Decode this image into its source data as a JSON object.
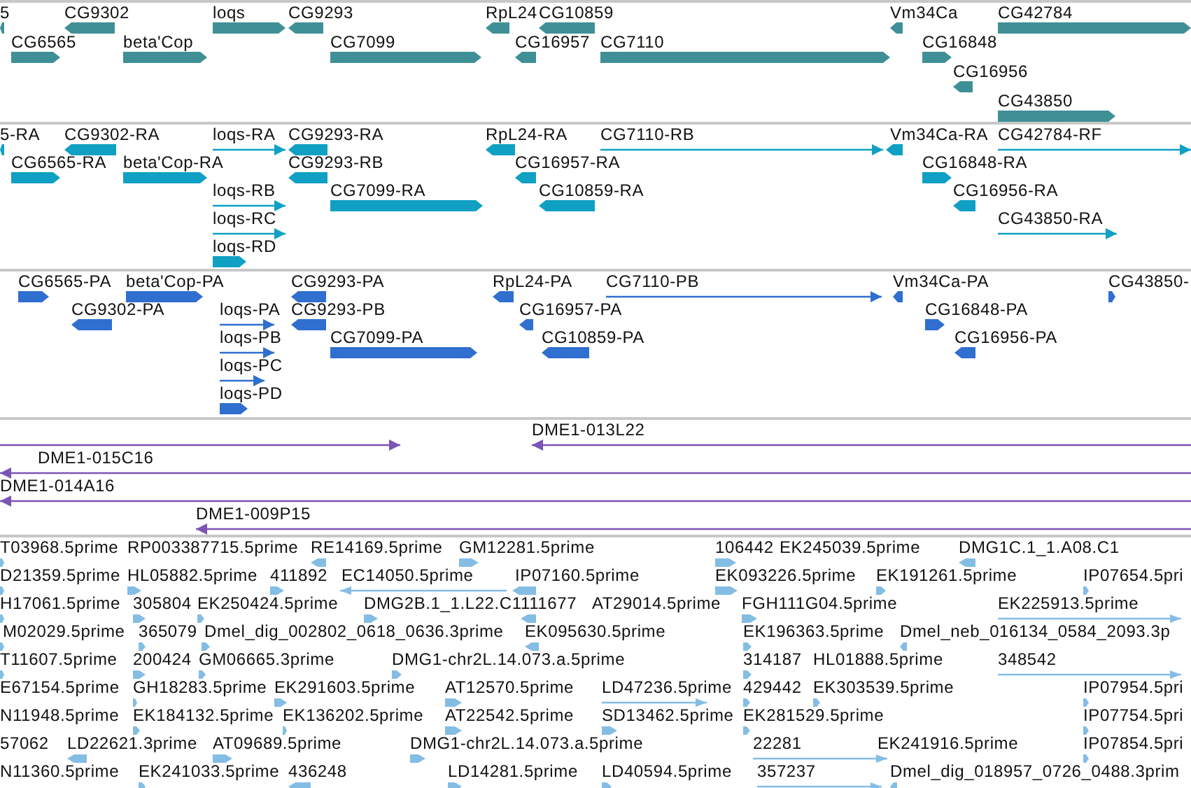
{
  "tracks": [
    {
      "kind": "gene",
      "features": [
        {
          "label": "5",
          "reverse": true
        },
        {
          "label": "CG9302",
          "reverse": true
        },
        {
          "label": "loqs",
          "reverse": false
        },
        {
          "label": "CG9293",
          "reverse": true
        },
        {
          "label": "RpL24",
          "reverse": true
        },
        {
          "label": "CG10859",
          "reverse": true
        },
        {
          "label": "Vm34Ca",
          "reverse": true
        },
        {
          "label": "CG42784",
          "reverse": false
        },
        {
          "label": "CG6565",
          "reverse": false
        },
        {
          "label": "beta'Cop",
          "reverse": false
        },
        {
          "label": "CG7099",
          "reverse": false
        },
        {
          "label": "CG16957",
          "reverse": true
        },
        {
          "label": "CG7110",
          "reverse": false
        },
        {
          "label": "CG16848",
          "reverse": false
        },
        {
          "label": "CG16956",
          "reverse": true
        },
        {
          "label": "CG43850",
          "reverse": false
        }
      ]
    },
    {
      "kind": "transcript",
      "features": [
        {
          "label": "5-RA",
          "reverse": true
        },
        {
          "label": "CG9302-RA",
          "reverse": true
        },
        {
          "label": "loqs-RA",
          "reverse": false
        },
        {
          "label": "CG9293-RA",
          "reverse": true
        },
        {
          "label": "RpL24-RA",
          "reverse": true
        },
        {
          "label": "CG7110-RB",
          "reverse": false
        },
        {
          "label": "Vm34Ca-RA",
          "reverse": true
        },
        {
          "label": "CG42784-RF",
          "reverse": false
        },
        {
          "label": "CG6565-RA",
          "reverse": false
        },
        {
          "label": "beta'Cop-RA",
          "reverse": false
        },
        {
          "label": "CG9293-RB",
          "reverse": true
        },
        {
          "label": "CG16957-RA",
          "reverse": true
        },
        {
          "label": "CG16848-RA",
          "reverse": false
        },
        {
          "label": "loqs-RB",
          "reverse": false
        },
        {
          "label": "CG7099-RA",
          "reverse": false
        },
        {
          "label": "CG10859-RA",
          "reverse": true
        },
        {
          "label": "CG16956-RA",
          "reverse": true
        },
        {
          "label": "loqs-RC",
          "reverse": false
        },
        {
          "label": "CG43850-RA",
          "reverse": false
        },
        {
          "label": "loqs-RD",
          "reverse": false
        }
      ]
    },
    {
      "kind": "protein",
      "features": [
        {
          "label": "CG6565-PA",
          "reverse": false
        },
        {
          "label": "beta'Cop-PA",
          "reverse": false
        },
        {
          "label": "CG9293-PA",
          "reverse": true
        },
        {
          "label": "RpL24-PA",
          "reverse": true
        },
        {
          "label": "CG7110-PB",
          "reverse": false
        },
        {
          "label": "Vm34Ca-PA",
          "reverse": true
        },
        {
          "label": "CG43850-",
          "reverse": false
        },
        {
          "label": "CG9302-PA",
          "reverse": true
        },
        {
          "label": "loqs-PA",
          "reverse": false
        },
        {
          "label": "CG9293-PB",
          "reverse": true
        },
        {
          "label": "CG16957-PA",
          "reverse": true
        },
        {
          "label": "CG16848-PA",
          "reverse": false
        },
        {
          "label": "loqs-PB",
          "reverse": false
        },
        {
          "label": "CG7099-PA",
          "reverse": false
        },
        {
          "label": "CG10859-PA",
          "reverse": true
        },
        {
          "label": "CG16956-PA",
          "reverse": true
        },
        {
          "label": "loqs-PC",
          "reverse": false
        },
        {
          "label": "loqs-PD",
          "reverse": false
        }
      ]
    },
    {
      "kind": "clone",
      "features": [
        {
          "reverse": false
        },
        {
          "label": "DME1-013L22",
          "reverse": true
        },
        {
          "label": "DME1-015C16",
          "reverse": true
        },
        {
          "label": "DME1-014A16",
          "reverse": true
        },
        {
          "label": "DME1-009P15",
          "reverse": true
        }
      ]
    },
    {
      "kind": "est",
      "features": [
        {
          "label": "T03968.5prime",
          "reverse": false
        },
        {
          "label": "RP003387715.5prime"
        },
        {
          "label": "RE14169.5prime",
          "reverse": true
        },
        {
          "label": "GM12281.5prime",
          "reverse": false
        },
        {
          "label": "106442",
          "reverse": false
        },
        {
          "label": "EK245039.5prime"
        },
        {
          "label": "DMG1C.1_1.A08.C1",
          "reverse": true
        },
        {
          "label": "D21359.5prime",
          "reverse": false
        },
        {
          "label": "HL05882.5prime",
          "reverse": false
        },
        {
          "label": "411892",
          "reverse": false
        },
        {
          "label": "EC14050.5prime",
          "reverse": true
        },
        {
          "label": "IP07160.5prime",
          "reverse": true
        },
        {
          "label": "EK093226.5prime",
          "reverse": false
        },
        {
          "label": "EK191261.5prime",
          "reverse": false
        },
        {
          "label": "IP07654.5pri",
          "reverse": false
        },
        {
          "label": "H17061.5prime",
          "reverse": false
        },
        {
          "label": "305804",
          "reverse": false
        },
        {
          "label": "EK250424.5prime",
          "reverse": false
        },
        {
          "label": "DMG2B.1_1.L22.C1",
          "reverse": false
        },
        {
          "label": "111677",
          "reverse": true
        },
        {
          "label": "AT29014.5prime"
        },
        {
          "label": "FGH111G04.5prime",
          "reverse": false
        },
        {
          "label": "EK225913.5prime",
          "reverse": false
        },
        {
          "label": "M02029.5prime",
          "reverse": false
        },
        {
          "label": "365079",
          "reverse": false
        },
        {
          "label": "Dmel_dig_002802_0618_0636.3prime",
          "reverse": false
        },
        {
          "label": "EK095630.5prime",
          "reverse": true
        },
        {
          "label": "EK196363.5prime",
          "reverse": false
        },
        {
          "label": "Dmel_neb_016134_0584_2093.3p",
          "reverse": true
        },
        {
          "label": "T11607.5prime",
          "reverse": false
        },
        {
          "label": "200424",
          "reverse": false
        },
        {
          "label": "GM06665.3prime",
          "reverse": false
        },
        {
          "label": "DMG1-chr2L.14.073.a.5prime",
          "reverse": false
        },
        {
          "label": "314187",
          "reverse": false
        },
        {
          "label": "HL01888.5prime"
        },
        {
          "label": "348542",
          "reverse": false
        },
        {
          "label": "E67154.5prime"
        },
        {
          "label": "GH18283.5prime",
          "reverse": false
        },
        {
          "label": "EK291603.5prime",
          "reverse": false
        },
        {
          "label": "AT12570.5prime",
          "reverse": false
        },
        {
          "label": "LD47236.5prime",
          "reverse": false
        },
        {
          "label": "429442",
          "reverse": false
        },
        {
          "label": "EK303539.5prime",
          "reverse": false
        },
        {
          "label": "IP07954.5pri",
          "reverse": false
        },
        {
          "label": "N11948.5prime"
        },
        {
          "label": "EK184132.5prime",
          "reverse": false
        },
        {
          "label": "EK136202.5prime",
          "reverse": false
        },
        {
          "label": "AT22542.5prime",
          "reverse": false
        },
        {
          "label": "SD13462.5prime",
          "reverse": false
        },
        {
          "label": "EK281529.5prime",
          "reverse": false
        },
        {
          "label": "IP07754.5pri",
          "reverse": false
        },
        {
          "label": "57062"
        },
        {
          "label": "LD22621.3prime",
          "reverse": true
        },
        {
          "label": "AT09689.5prime",
          "reverse": false
        },
        {
          "label": "DMG1-chr2L.14.073.a.5prime",
          "reverse": false
        },
        {
          "label": "22281",
          "reverse": false
        },
        {
          "label": "EK241916.5prime"
        },
        {
          "label": "IP07854.5pri",
          "reverse": false
        },
        {
          "label": "N11360.5prime"
        },
        {
          "label": "EK241033.5prime",
          "reverse": false
        },
        {
          "label": "436248",
          "reverse": true
        },
        {
          "label": "LD14281.5prime",
          "reverse": false
        },
        {
          "label": "LD40594.5prime",
          "reverse": false
        },
        {
          "label": "357237",
          "reverse": false
        },
        {
          "label": "Dmel_dig_018957_0726_0488.3prim",
          "reverse": true
        }
      ]
    }
  ]
}
